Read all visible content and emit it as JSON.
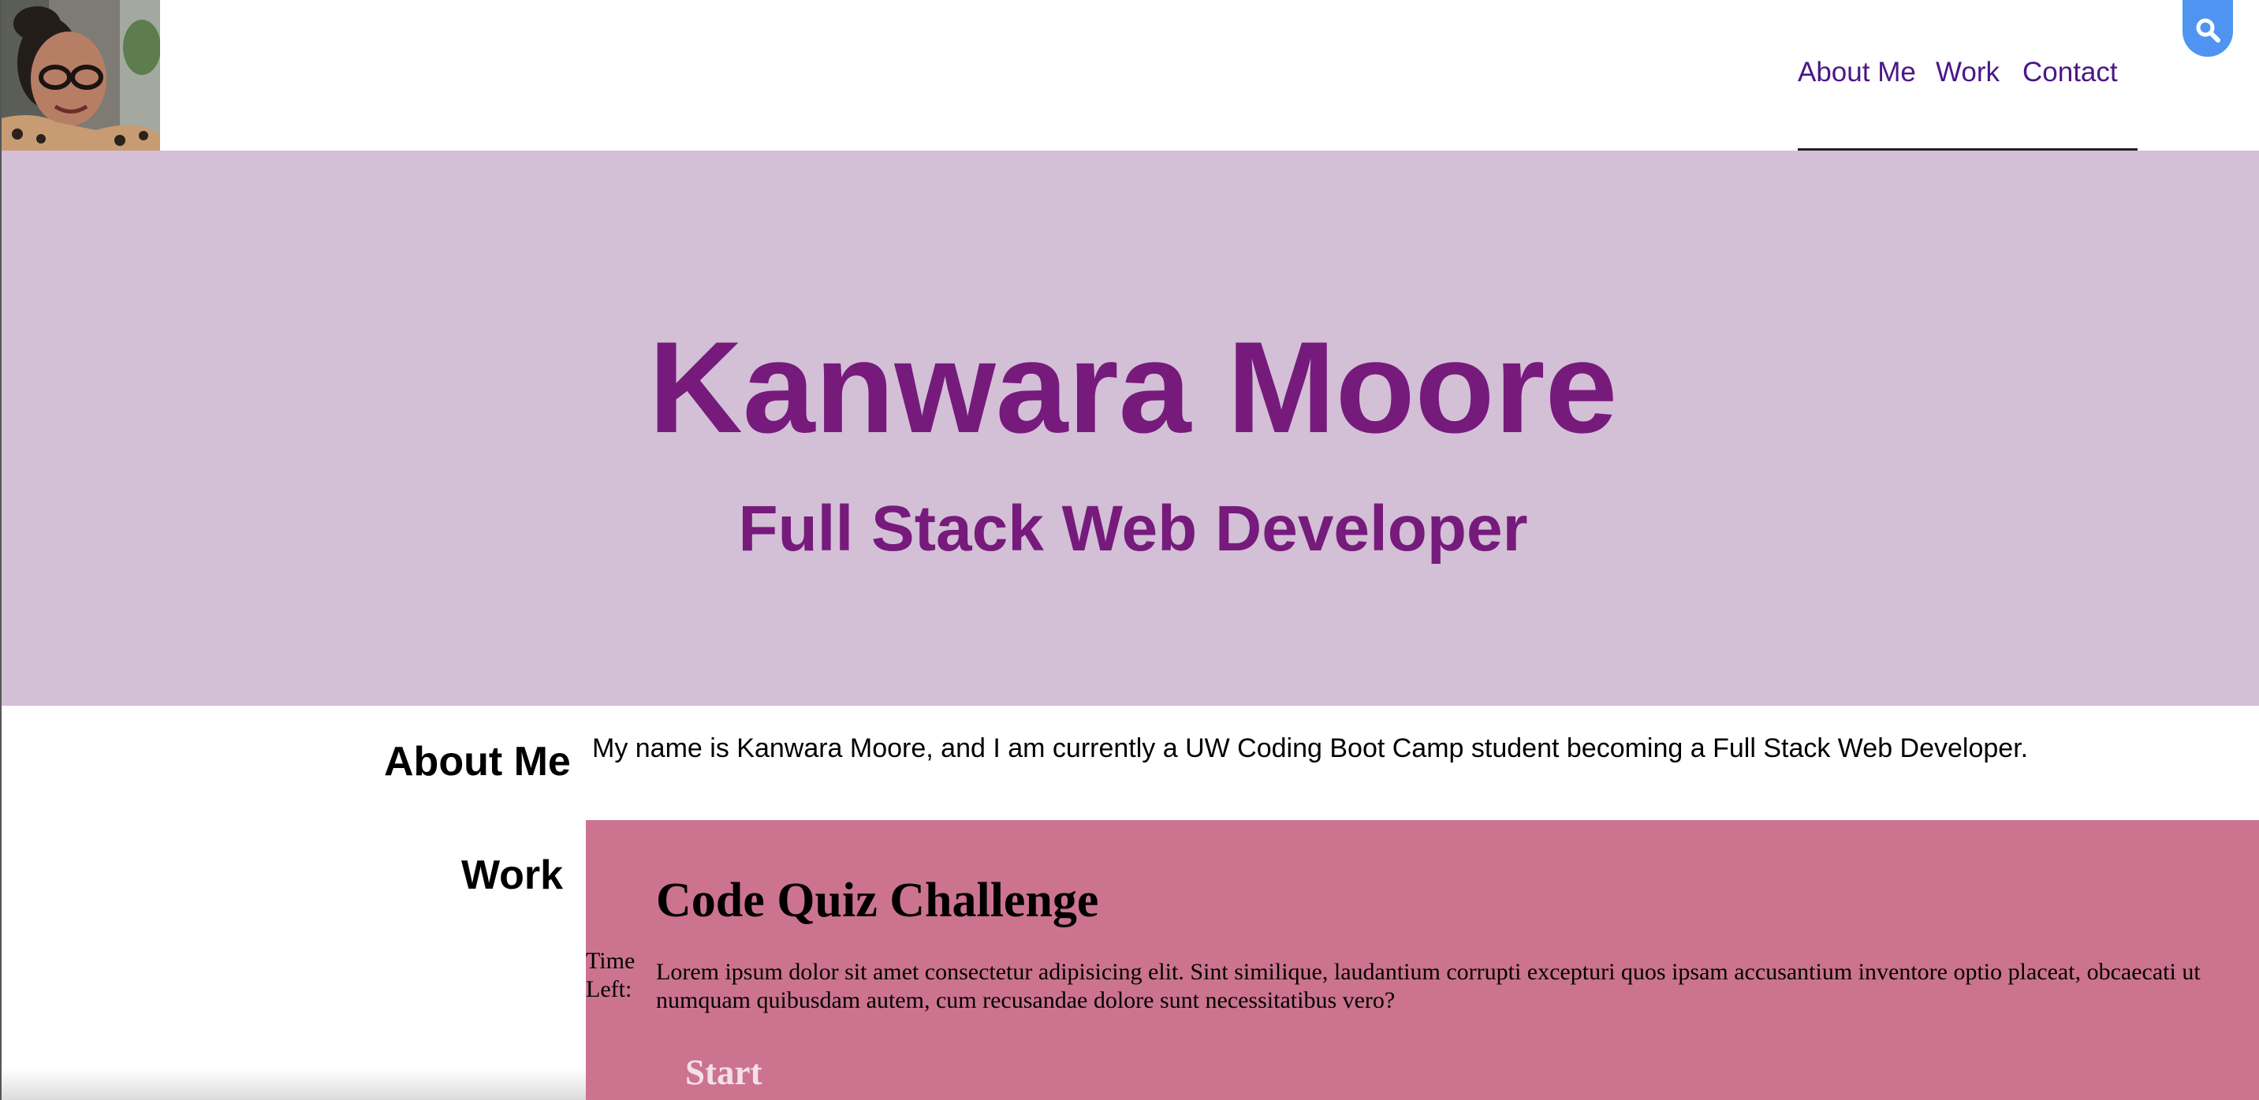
{
  "header": {
    "nav": [
      {
        "label": "About Me"
      },
      {
        "label": "Work"
      },
      {
        "label": "Contact"
      }
    ]
  },
  "hero": {
    "name": "Kanwara Moore",
    "subtitle": "Full Stack Web Developer"
  },
  "about": {
    "heading": "About Me",
    "text": "My name is Kanwara Moore, and I am currently a UW Coding Boot Camp student becoming a Full Stack Web Developer."
  },
  "work": {
    "heading": "Work",
    "card": {
      "time_label": "Time Left:",
      "title": "Code Quiz Challenge",
      "description": "Lorem ipsum dolor sit amet consectetur adipisicing elit. Sint similique, laudantium corrupti excepturi quos ipsam accusantium inventore optio placeat, obcaecati ut numquam quibusdam autem, cum recusandae dolore sunt necessitatibus vero?",
      "start_label": "Start"
    }
  },
  "colors": {
    "hero_bg": "#d3bfd6",
    "hero_text": "#761a7c",
    "nav_link": "#4b1687",
    "card_bg": "#cc738f",
    "search_btn": "#4f94f0"
  },
  "icons": {
    "search_button": "search-icon"
  }
}
